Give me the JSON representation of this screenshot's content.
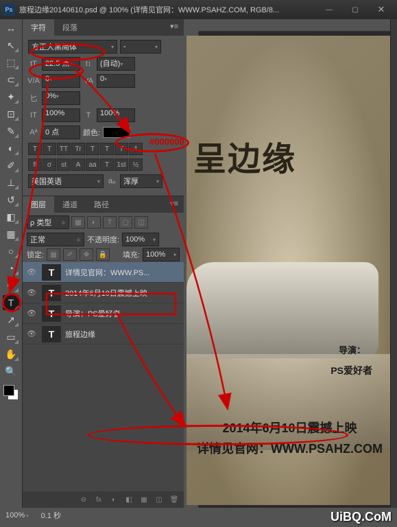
{
  "titlebar": {
    "ps": "Ps",
    "title": "旅程边缘20140610.psd @ 100% (详情见官网：WWW.PSAHZ.COM, RGB/8...",
    "min": "—",
    "max": "▢",
    "close": "✕"
  },
  "char_panel": {
    "tabs": [
      "字符",
      "段落"
    ],
    "font_family": "方正大黑简体",
    "font_style": "-",
    "size_icon": "tT",
    "font_size": "22.5 点",
    "leading_icon": "t↕",
    "leading": "(自动)",
    "va_icon": "V/A",
    "tracking": "0",
    "va2_icon": "VA",
    "va2": "0",
    "scale_icon": "匕",
    "scale": "0%",
    "vscale": "100%",
    "hscale": "100%",
    "baseline_icon": "Aª",
    "baseline": "0 点",
    "color_label": "颜色:",
    "color_value": "#000000",
    "type_row1": [
      "T",
      "T",
      "TT",
      "Tr",
      "T",
      "T",
      "T",
      "‡"
    ],
    "type_row2": [
      "fi",
      "σ",
      "st",
      "A",
      "aa",
      "T",
      "1st",
      "½"
    ],
    "lang": "美国英语",
    "aa_icon": "aₐ",
    "aa": "浑厚"
  },
  "layers_panel": {
    "tabs": [
      "图层",
      "通道",
      "路径"
    ],
    "kind_label": "ρ 类型",
    "filters": [
      "▦",
      "◐",
      "T",
      "▢",
      "◫"
    ],
    "blend": "正常",
    "opacity_label": "不透明度:",
    "opacity": "100%",
    "lock_label": "锁定:",
    "fill_label": "填充:",
    "fill": "100%",
    "layers": [
      {
        "name": "详情见官网：WWW.PS...",
        "selected": true
      },
      {
        "name": "2014年6月10日震撼上映",
        "selected": false
      },
      {
        "name": "导演：PS爱好者",
        "selected": false
      },
      {
        "name": "旅程边缘",
        "selected": false
      }
    ],
    "bottom_icons": [
      "⊖",
      "fx",
      "◐",
      "◧",
      "▦",
      "◫",
      "✍",
      "🗑"
    ]
  },
  "canvas": {
    "title": "呈边缘",
    "director_label": "导演：",
    "director": "PS爱好者",
    "release": "2014年6月10日震撼上映",
    "website": "详情见官网：WWW.PSAHZ.COM",
    "watermark": "UiBQ.CoM"
  },
  "status": {
    "zoom": "100%",
    "timing": "0.1 秒"
  },
  "tools": {
    "arrow": "↔",
    "move": "↖",
    "marquee": "⬚",
    "lasso": "⊂",
    "wand": "✦",
    "crop": "⊡",
    "eyedrop": "✎",
    "spot": "◐",
    "brush": "✐",
    "stamp": "⊥",
    "history": "↺",
    "eraser": "◧",
    "gradient": "▦",
    "blur": "○",
    "dodge": "◔",
    "pen": "✒",
    "type": "T",
    "path": "↗",
    "shape": "▭",
    "hand": "✋",
    "zoom": "🔍"
  }
}
